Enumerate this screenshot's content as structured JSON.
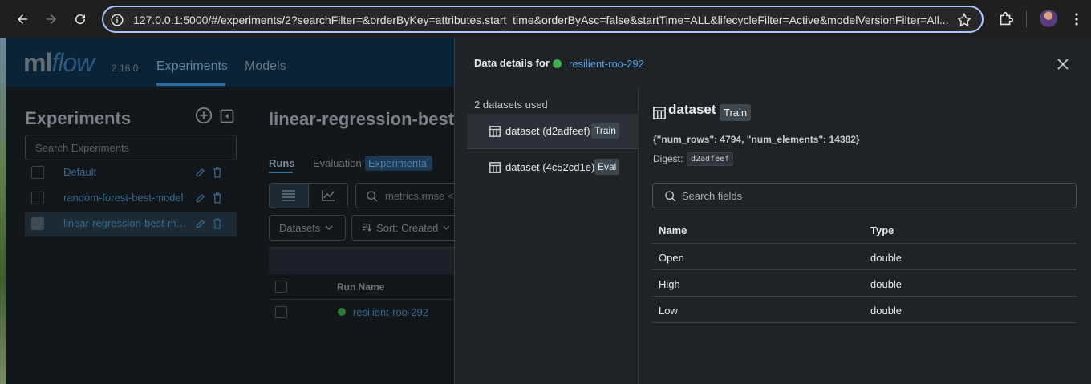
{
  "browser": {
    "url": "127.0.0.1:5000/#/experiments/2?searchFilter=&orderByKey=attributes.start_time&orderByAsc=false&startTime=ALL&lifecycleFilter=Active&modelVersionFilter=All..."
  },
  "app": {
    "logo_ml": "ml",
    "logo_flow": "flow",
    "version": "2.16.0",
    "nav": [
      "Experiments",
      "Models"
    ]
  },
  "sidebar": {
    "title": "Experiments",
    "search_placeholder": "Search Experiments",
    "experiments": [
      {
        "name": "Default",
        "selected": false
      },
      {
        "name": "random-forest-best-model",
        "selected": false
      },
      {
        "name": "linear-regression-best-model",
        "selected": true
      }
    ]
  },
  "main": {
    "title": "linear-regression-best-m",
    "tabs": [
      "Runs",
      "Evaluation"
    ],
    "experimental_badge": "Experimental",
    "filter_text": "metrics.rmse <",
    "datasets_label": "Datasets",
    "sort_label": "Sort: Created",
    "column_run_name": "Run Name",
    "run_name": "resilient-roo-292"
  },
  "drawer": {
    "title": "Data details for",
    "run_name": "resilient-roo-292",
    "datasets_count": "2 datasets used",
    "datasets": [
      {
        "name": "dataset (d2adfeef)",
        "context": "Train",
        "selected": true
      },
      {
        "name": "dataset (4c52cd1e)",
        "context": "Eval",
        "selected": false
      }
    ],
    "detail": {
      "name": "dataset",
      "context": "Train",
      "profile": "{\"num_rows\": 4794, \"num_elements\": 14382}",
      "digest_label": "Digest:",
      "digest": "d2adfeef",
      "search_placeholder": "Search fields",
      "columns": [
        "Name",
        "Type"
      ],
      "rows": [
        {
          "name": "Open",
          "type": "double"
        },
        {
          "name": "High",
          "type": "double"
        },
        {
          "name": "Low",
          "type": "double"
        }
      ]
    }
  },
  "colors": {
    "accent_link": "#4ea0ea",
    "run_status": "#3fae5a"
  }
}
